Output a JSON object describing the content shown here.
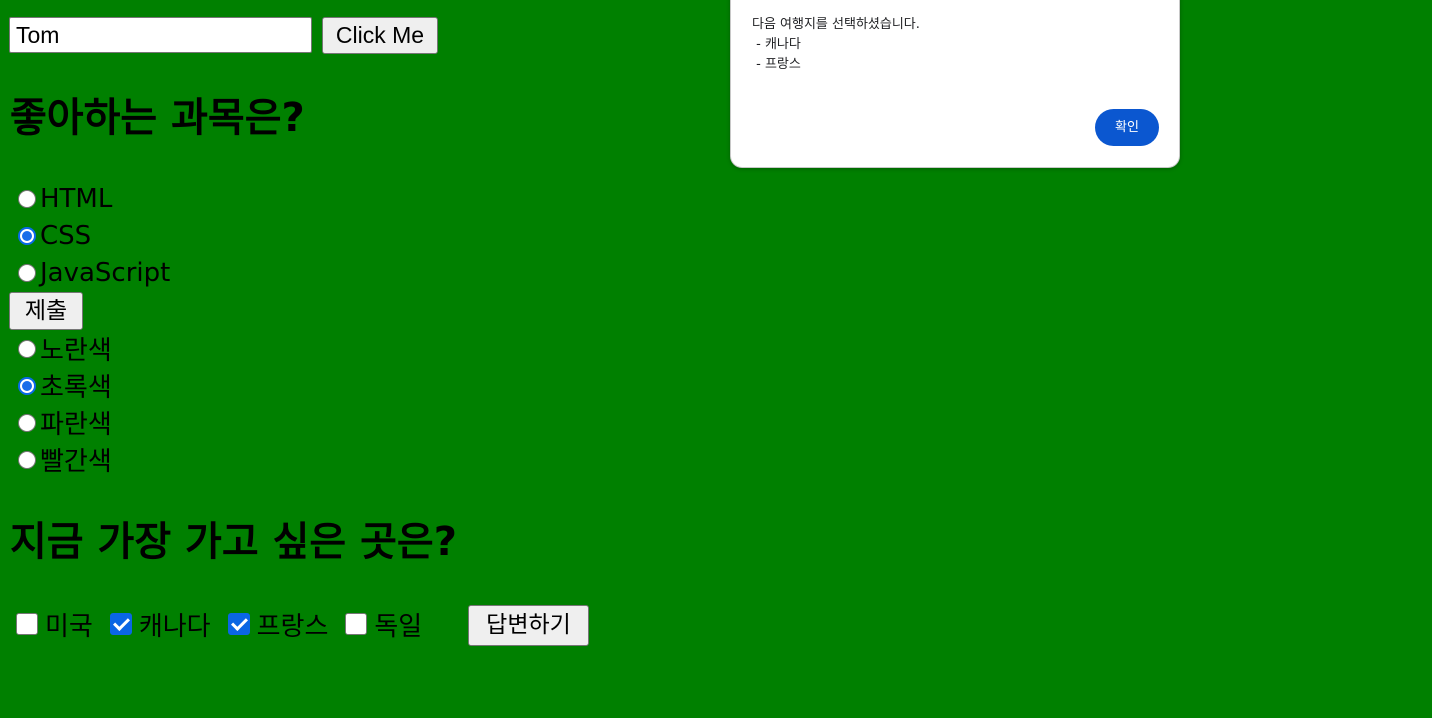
{
  "form": {
    "name_value": "Tom",
    "click_label": "Click Me"
  },
  "subject_question": {
    "heading": "좋아하는 과목은?",
    "options": [
      {
        "label": "HTML",
        "checked": false
      },
      {
        "label": "CSS",
        "checked": true
      },
      {
        "label": "JavaScript",
        "checked": false
      }
    ],
    "submit_label": "제출"
  },
  "color_options": [
    {
      "label": "노란색",
      "checked": false
    },
    {
      "label": "초록색",
      "checked": true
    },
    {
      "label": "파란색",
      "checked": false
    },
    {
      "label": "빨간색",
      "checked": false
    }
  ],
  "place_question": {
    "heading": "지금 가장 가고 싶은 곳은?",
    "options": [
      {
        "label": "미국",
        "checked": false
      },
      {
        "label": "캐나다",
        "checked": true
      },
      {
        "label": "프랑스",
        "checked": true
      },
      {
        "label": "독일",
        "checked": false
      }
    ],
    "answer_label": "답변하기"
  },
  "dialog": {
    "message": "다음 여행지를 선택하셨습니다.\n - 캐나다\n - 프랑스",
    "ok_label": "확인"
  },
  "colors": {
    "page_background": "#008000",
    "accent": "#0b57d0"
  }
}
